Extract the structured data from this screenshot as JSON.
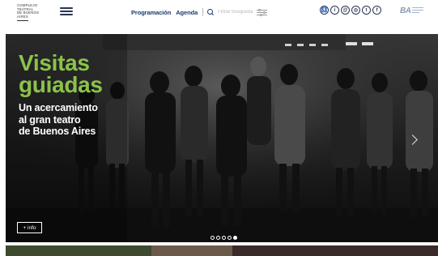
{
  "header": {
    "logo_lines": [
      "COMPLEJO",
      "TEATRAL",
      "DE BUENOS",
      "AIRES"
    ],
    "nav": [
      {
        "label": "Programación"
      },
      {
        "label": "Agenda"
      }
    ],
    "search": {
      "placeholder": "Filtrar búsqueda por"
    },
    "socials": [
      {
        "name": "accessibility-icon",
        "glyph": "♿"
      },
      {
        "name": "info-icon",
        "glyph": "i"
      },
      {
        "name": "email-icon",
        "glyph": "@"
      },
      {
        "name": "instagram-icon",
        "glyph": "◎"
      },
      {
        "name": "twitter-icon",
        "glyph": "t"
      },
      {
        "name": "facebook-icon",
        "glyph": "f"
      }
    ],
    "ba_logo": "BA"
  },
  "hero": {
    "title_line1": "Visitas",
    "title_line2": "guiadas",
    "subtitle_lines": [
      "Un acercamiento",
      "al gran teatro",
      "de Buenos Aires"
    ],
    "info_button": "+ info",
    "slides_total": 5,
    "active_slide": 5,
    "title_color": "#8bc34a"
  },
  "colors": {
    "nav_text": "#1e3a6e",
    "accent_green": "#8bc34a"
  }
}
